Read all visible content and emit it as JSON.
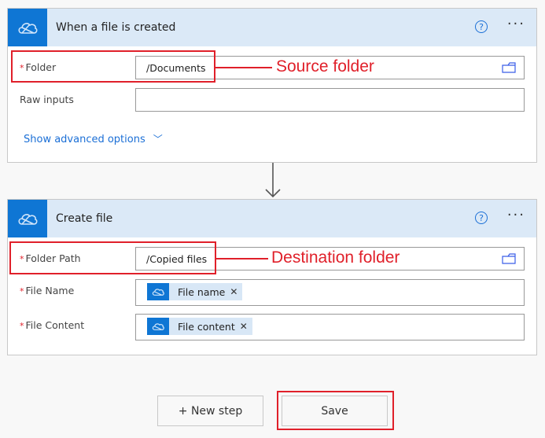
{
  "trigger": {
    "title": "When a file is created",
    "help_icon": "question-circle-icon",
    "more_icon": "ellipsis-icon",
    "fields": [
      {
        "label": "Folder",
        "required": true,
        "value": "/Documents",
        "has_folder_picker": true
      },
      {
        "label": "Raw inputs",
        "required": false,
        "value": ""
      }
    ],
    "advanced_link": "Show advanced options",
    "required_marker": "*"
  },
  "action": {
    "title": "Create file",
    "fields": [
      {
        "label": "Folder Path",
        "required": true,
        "value": "/Copied files",
        "has_folder_picker": true
      },
      {
        "label": "File Name",
        "required": true,
        "token": "File name"
      },
      {
        "label": "File Content",
        "required": true,
        "token": "File content"
      }
    ],
    "required_marker": "*"
  },
  "annotations": {
    "source": "Source folder",
    "destination": "Destination folder",
    "color": "#e0202a"
  },
  "buttons": {
    "new_step": "+ New step",
    "save": "Save"
  },
  "glyphs": {
    "help": "?",
    "more": "···",
    "chevron": "﹀",
    "remove": "✕"
  },
  "colors": {
    "connector_blue": "#0f76d4",
    "header_bg": "#dbe9f7",
    "link_blue": "#1b6fd6"
  }
}
